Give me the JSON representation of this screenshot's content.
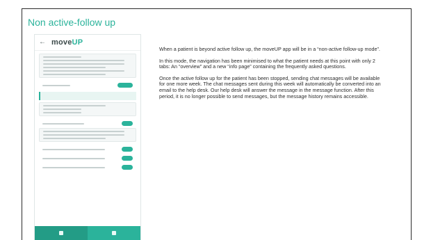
{
  "slide": {
    "title": "Non active-follow up"
  },
  "phone": {
    "logo_prefix": "move",
    "logo_suffix": "UP",
    "back_glyph": "arrow-left-icon",
    "tabs": [
      {
        "icon": "overview-icon",
        "active": true
      },
      {
        "icon": "info-icon",
        "active": false
      }
    ]
  },
  "content": {
    "paragraphs": [
      "When a patient is beyond active follow up, the moveUP app will be in a “non-active follow-up mode”.",
      "In this mode, the navigation has been minimised to what the patient needs at this point with only 2 tabs: An “overview” and a new “info page” containing the frequently asked questions.",
      "Once the active follow up for the patient has been stopped, sending chat messages will be available for one more week. The chat messages sent during this week will automatically be converted into an email to the help desk. Our help desk will answer the message in the message function. After this period, it is no longer possible to send messages, but the message history remains accessible."
    ]
  },
  "colors": {
    "accent": "#2bb39b",
    "text": "#2d2d2d",
    "border": "#2a2a2a"
  }
}
